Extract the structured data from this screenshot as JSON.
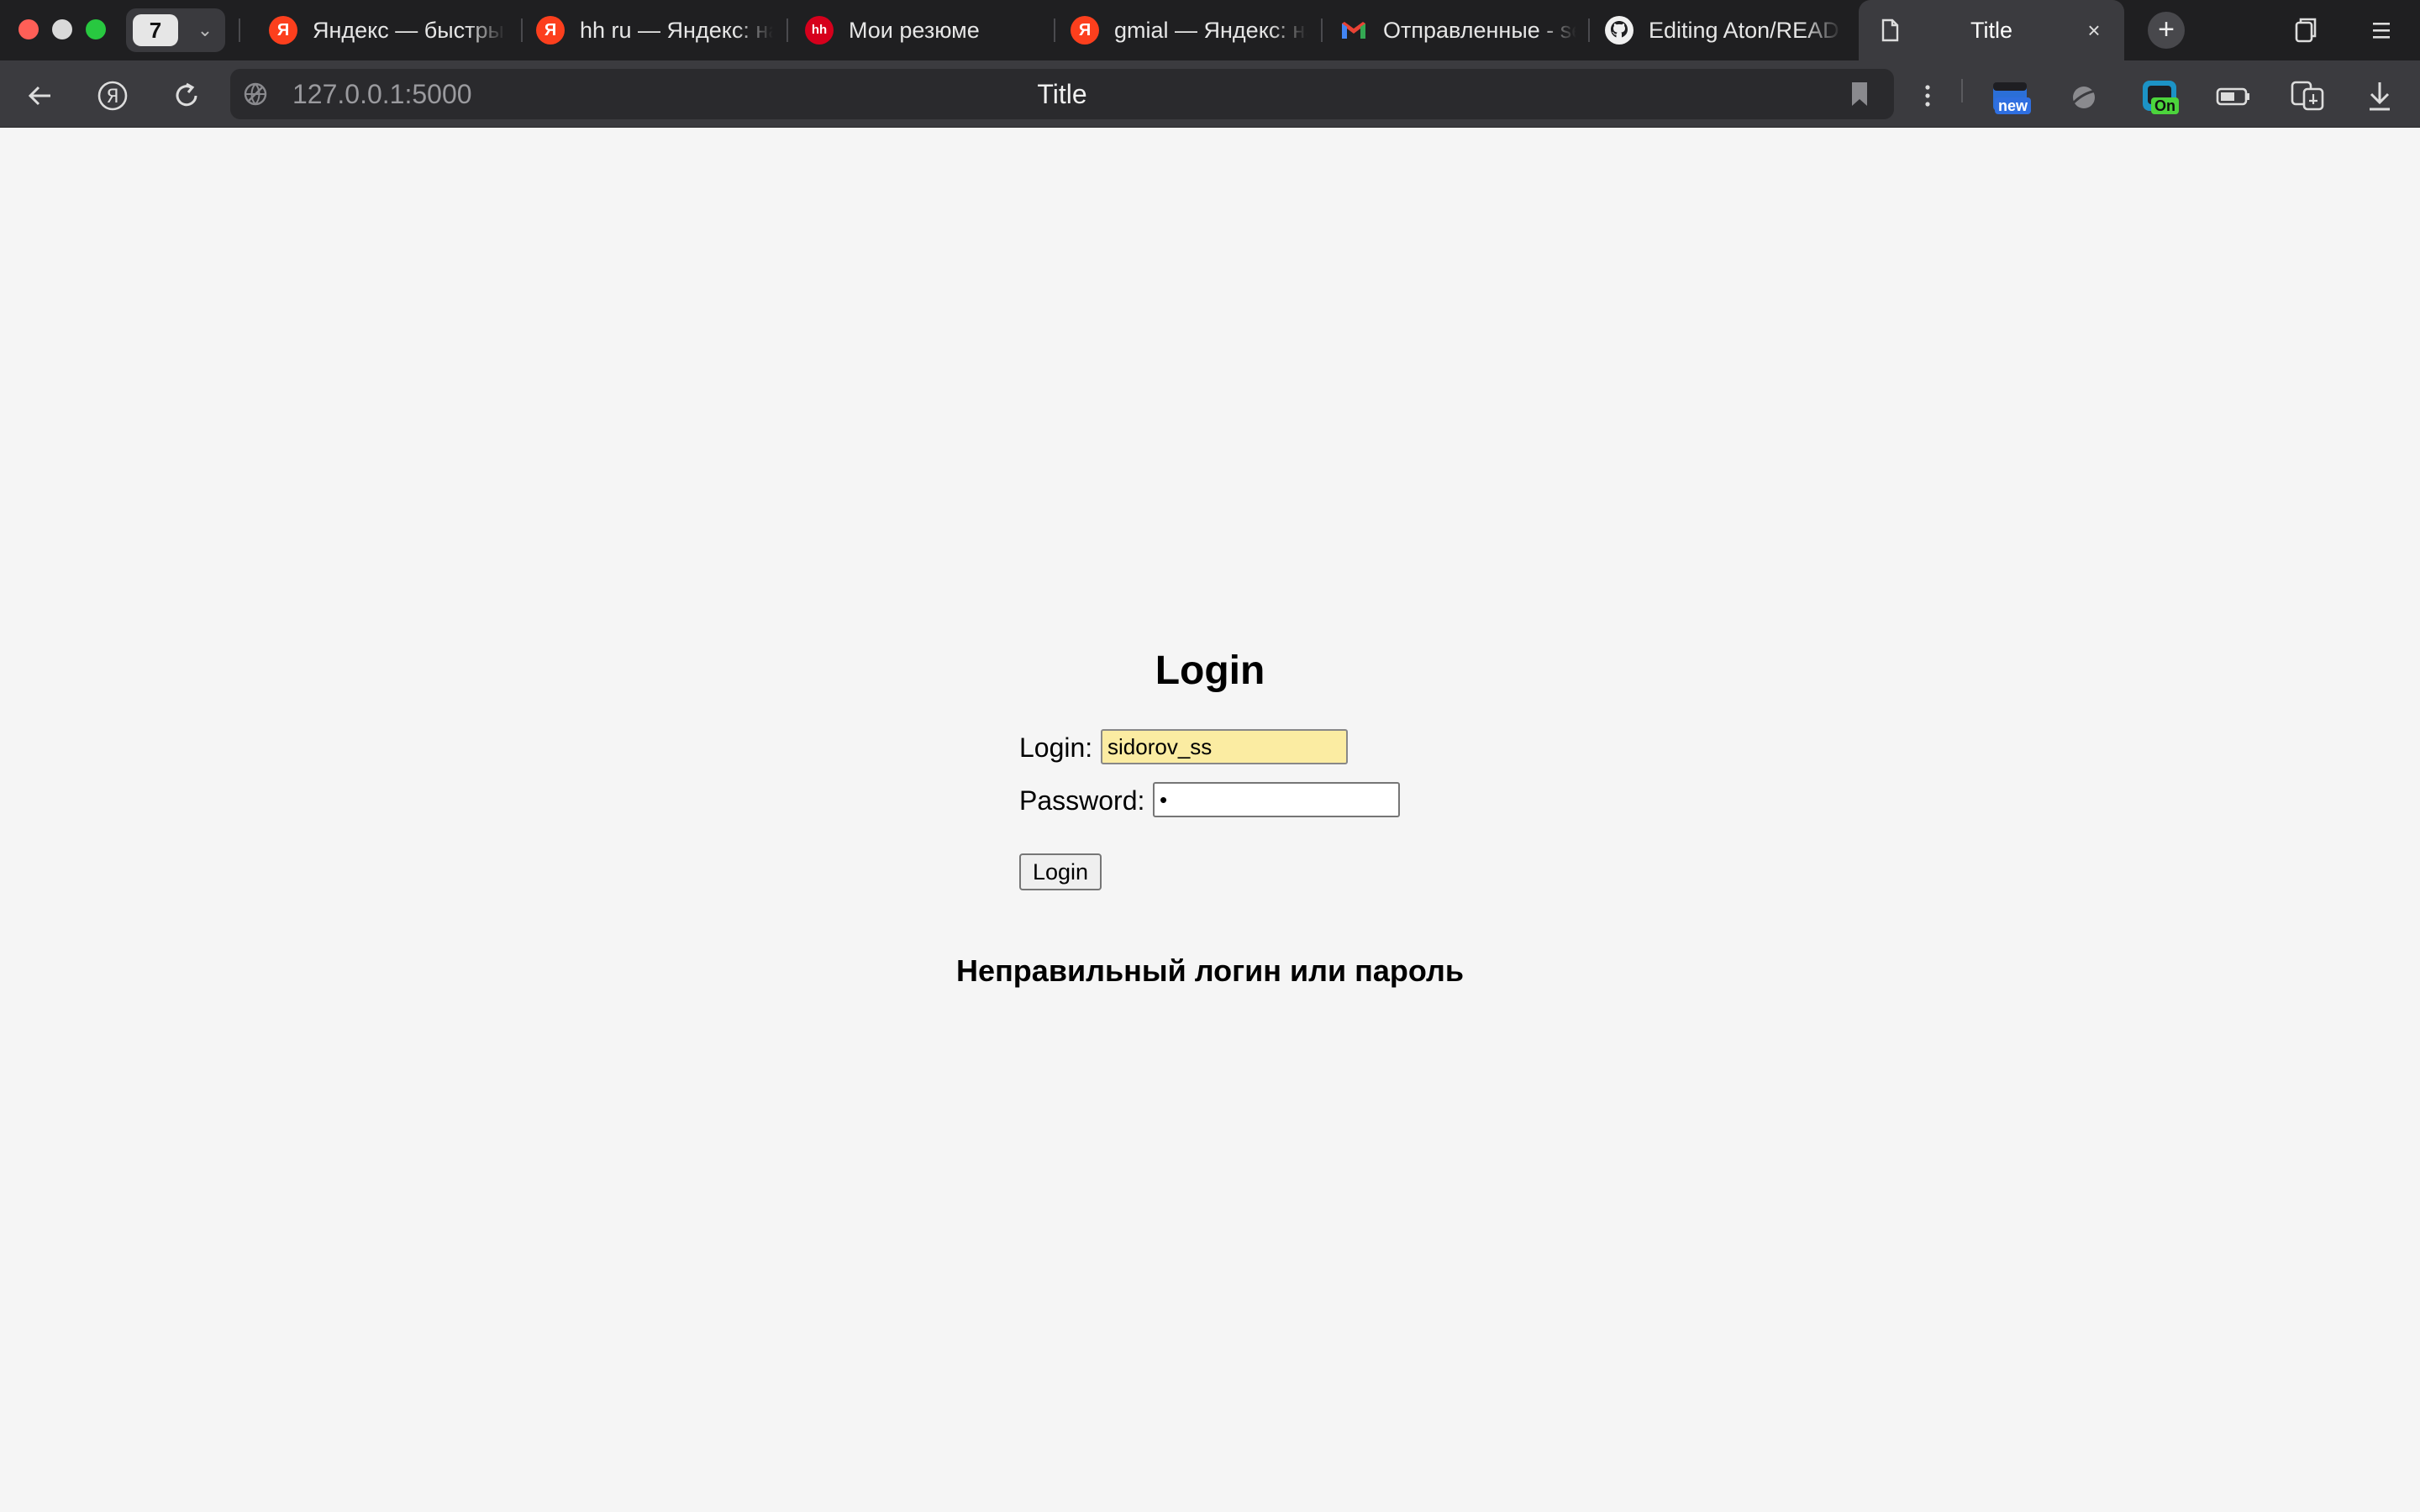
{
  "browser": {
    "tab_count": "7",
    "tabs": [
      {
        "title": "Яндекс — быстрый",
        "icon": "yandex-icon"
      },
      {
        "title": "hh ru — Яндекс: на",
        "icon": "yandex-icon"
      },
      {
        "title": "Мои резюме",
        "icon": "hh-icon",
        "icon_text": "hh"
      },
      {
        "title": "gmial — Яндекс: на",
        "icon": "yandex-icon"
      },
      {
        "title": "Отправленные - se",
        "icon": "gmail-icon"
      },
      {
        "title": "Editing Aton/READ",
        "icon": "github-icon"
      },
      {
        "title": "Title",
        "icon": "document-icon",
        "active": true
      }
    ],
    "address": {
      "url": "127.0.0.1:5000",
      "page_title": "Title"
    },
    "extensions": [
      {
        "icon": "calendar-extension-icon",
        "badge": "new",
        "badge_color": "#2f6fe0"
      },
      {
        "icon": "vpn-extension-icon"
      },
      {
        "icon": "proxy-extension-icon",
        "badge": "On",
        "badge_color": "#4cd43c"
      },
      {
        "icon": "battery-icon"
      },
      {
        "icon": "translate-icon"
      },
      {
        "icon": "download-icon"
      }
    ],
    "colors": {
      "chrome_bg": "#1f1f21",
      "toolbar_bg": "#3b3b3f",
      "yandex_red": "#fc3f1d"
    }
  },
  "page": {
    "heading": "Login",
    "login_label": "Login:",
    "login_value": "sidorov_ss",
    "password_label": "Password:",
    "password_value": "•",
    "submit_label": "Login",
    "error_message": "Неправильный логин или пароль",
    "colors": {
      "background": "#f5f5f5",
      "autofill": "#fbeca2"
    }
  }
}
